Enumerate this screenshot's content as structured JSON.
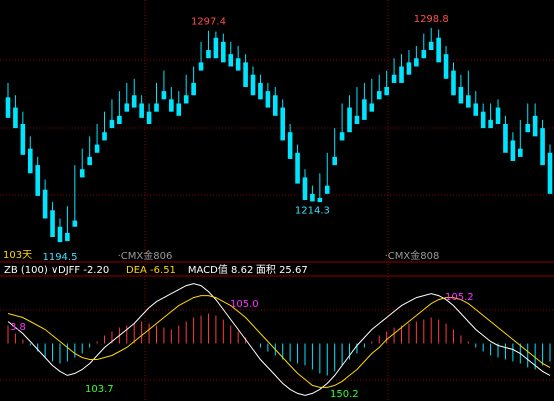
{
  "chart_data": [
    {
      "type": "candlestick",
      "annotations": [
        {
          "label": "1297.4",
          "value": 1297.4
        },
        {
          "label": "1298.8",
          "value": 1298.8
        },
        {
          "label": "1214.3",
          "value": 1214.3
        },
        {
          "label": "1194.5",
          "value": 1194.5
        }
      ],
      "bottom_left": "103天",
      "period_labels": [
        "CMX金806",
        "CMX金808"
      ],
      "colors": {
        "up": "#ff3b3b",
        "down": "#00e5ff",
        "grid": "#8b0000"
      },
      "candles": [
        [
          1265,
          1272,
          1258,
          1255
        ],
        [
          1260,
          1266,
          1253,
          1250
        ],
        [
          1252,
          1258,
          1240,
          1237
        ],
        [
          1240,
          1246,
          1232,
          1228
        ],
        [
          1232,
          1236,
          1220,
          1217
        ],
        [
          1220,
          1225,
          1210,
          1206
        ],
        [
          1210,
          1214,
          1200,
          1197
        ],
        [
          1202,
          1206,
          1198,
          1194.5
        ],
        [
          1199,
          1212,
          1197,
          1195
        ],
        [
          1205,
          1232,
          1203,
          1202
        ],
        [
          1230,
          1240,
          1228,
          1226
        ],
        [
          1236,
          1246,
          1234,
          1232
        ],
        [
          1242,
          1252,
          1240,
          1238
        ],
        [
          1248,
          1258,
          1246,
          1244
        ],
        [
          1254,
          1264,
          1252,
          1250
        ],
        [
          1256,
          1268,
          1254,
          1252
        ],
        [
          1262,
          1272,
          1260,
          1258
        ],
        [
          1266,
          1274,
          1262,
          1260
        ],
        [
          1262,
          1266,
          1258,
          1255
        ],
        [
          1258,
          1262,
          1256,
          1252
        ],
        [
          1262,
          1272,
          1260,
          1258
        ],
        [
          1268,
          1278,
          1266,
          1264
        ],
        [
          1264,
          1270,
          1260,
          1258
        ],
        [
          1262,
          1268,
          1258,
          1256
        ],
        [
          1266,
          1276,
          1264,
          1262
        ],
        [
          1272,
          1280,
          1268,
          1266
        ],
        [
          1282,
          1292,
          1280,
          1278
        ],
        [
          1288,
          1297.4,
          1286,
          1284
        ],
        [
          1294,
          1297,
          1286,
          1284
        ],
        [
          1292,
          1296,
          1284,
          1282
        ],
        [
          1286,
          1292,
          1282,
          1280
        ],
        [
          1284,
          1290,
          1280,
          1278
        ],
        [
          1282,
          1286,
          1272,
          1270
        ],
        [
          1276,
          1280,
          1268,
          1266
        ],
        [
          1272,
          1276,
          1266,
          1264
        ],
        [
          1268,
          1272,
          1262,
          1260
        ],
        [
          1266,
          1270,
          1258,
          1256
        ],
        [
          1260,
          1264,
          1246,
          1244
        ],
        [
          1248,
          1252,
          1238,
          1235
        ],
        [
          1238,
          1242,
          1226,
          1223
        ],
        [
          1226,
          1230,
          1218,
          1215
        ],
        [
          1218,
          1222,
          1215,
          1214.3
        ],
        [
          1216,
          1228,
          1214.5,
          1214
        ],
        [
          1222,
          1238,
          1220,
          1218
        ],
        [
          1236,
          1250,
          1234,
          1232
        ],
        [
          1248,
          1262,
          1246,
          1244
        ],
        [
          1260,
          1266,
          1250,
          1248
        ],
        [
          1256,
          1270,
          1254,
          1252
        ],
        [
          1264,
          1272,
          1256,
          1254
        ],
        [
          1262,
          1274,
          1260,
          1258
        ],
        [
          1268,
          1276,
          1266,
          1264
        ],
        [
          1270,
          1278,
          1268,
          1266
        ],
        [
          1276,
          1284,
          1274,
          1272
        ],
        [
          1280,
          1286,
          1274,
          1272
        ],
        [
          1282,
          1288,
          1278,
          1276
        ],
        [
          1284,
          1290,
          1282,
          1280
        ],
        [
          1288,
          1296,
          1286,
          1284
        ],
        [
          1292,
          1298.8,
          1290,
          1288
        ],
        [
          1294,
          1298,
          1284,
          1282
        ],
        [
          1286,
          1290,
          1276,
          1274
        ],
        [
          1278,
          1282,
          1268,
          1266
        ],
        [
          1270,
          1276,
          1264,
          1262
        ],
        [
          1266,
          1278,
          1262,
          1260
        ],
        [
          1262,
          1268,
          1258,
          1256
        ],
        [
          1258,
          1262,
          1252,
          1250
        ],
        [
          1254,
          1262,
          1252,
          1250
        ],
        [
          1260,
          1264,
          1254,
          1252
        ],
        [
          1252,
          1256,
          1240,
          1238
        ],
        [
          1244,
          1248,
          1236,
          1234
        ],
        [
          1240,
          1254,
          1238,
          1236
        ],
        [
          1252,
          1262,
          1250,
          1248
        ],
        [
          1256,
          1262,
          1248,
          1246
        ],
        [
          1250,
          1254,
          1236,
          1232
        ],
        [
          1238,
          1242,
          1222,
          1218
        ]
      ]
    },
    {
      "type": "macd",
      "indicator": "ZB (100)",
      "readouts": [
        {
          "name": "DJFF",
          "value": "-2.20",
          "color": "#ffffff"
        },
        {
          "name": "DEA",
          "value": "-6.51",
          "color": "#ffd700"
        },
        {
          "name": "MACD值",
          "value": "8.62",
          "color": "#ffffff"
        },
        {
          "name": "面积",
          "value": "25.67",
          "color": "#ffffff"
        }
      ],
      "annotations": [
        {
          "label": "3.8",
          "color": "#ff33ff"
        },
        {
          "label": "103.7",
          "color": "#33ff33"
        },
        {
          "label": "105.0",
          "color": "#ff33ff"
        },
        {
          "label": "150.2",
          "color": "#33ff33"
        },
        {
          "label": "105.2",
          "color": "#ff33ff"
        }
      ],
      "histogram": [
        18,
        10,
        4,
        -2,
        -8,
        -14,
        -18,
        -20,
        -18,
        -14,
        -10,
        -4,
        2,
        8,
        12,
        16,
        18,
        20,
        22,
        20,
        18,
        16,
        14,
        18,
        22,
        26,
        28,
        30,
        28,
        24,
        18,
        12,
        6,
        0,
        -4,
        -8,
        -12,
        -16,
        -18,
        -20,
        -22,
        -26,
        -30,
        -32,
        -28,
        -22,
        -16,
        -10,
        -4,
        2,
        8,
        12,
        16,
        18,
        20,
        22,
        24,
        26,
        24,
        20,
        14,
        8,
        2,
        -4,
        -8,
        -12,
        -14,
        -16,
        -18,
        -20,
        -24,
        -26,
        -22,
        -18
      ],
      "diff": [
        22,
        16,
        10,
        2,
        -6,
        -14,
        -22,
        -28,
        -32,
        -30,
        -26,
        -20,
        -12,
        -4,
        2,
        8,
        14,
        20,
        28,
        36,
        42,
        46,
        50,
        54,
        58,
        60,
        58,
        52,
        44,
        34,
        24,
        14,
        4,
        -6,
        -16,
        -24,
        -32,
        -40,
        -46,
        -50,
        -52,
        -50,
        -46,
        -40,
        -32,
        -22,
        -12,
        -2,
        6,
        14,
        20,
        26,
        32,
        38,
        42,
        46,
        48,
        50,
        48,
        44,
        38,
        30,
        22,
        14,
        8,
        2,
        -2,
        -4,
        -6,
        -10,
        -16,
        -22,
        -28,
        -32
      ],
      "dea": [
        30,
        28,
        26,
        22,
        18,
        14,
        8,
        2,
        -4,
        -10,
        -14,
        -16,
        -16,
        -14,
        -12,
        -8,
        -4,
        2,
        8,
        14,
        20,
        26,
        32,
        38,
        42,
        46,
        48,
        48,
        46,
        42,
        38,
        32,
        26,
        18,
        10,
        2,
        -6,
        -14,
        -22,
        -30,
        -36,
        -42,
        -44,
        -44,
        -42,
        -38,
        -32,
        -26,
        -18,
        -10,
        -4,
        4,
        10,
        16,
        22,
        28,
        34,
        40,
        44,
        46,
        46,
        44,
        40,
        34,
        28,
        22,
        16,
        10,
        4,
        -2,
        -8,
        -14,
        -20,
        -24
      ]
    }
  ]
}
